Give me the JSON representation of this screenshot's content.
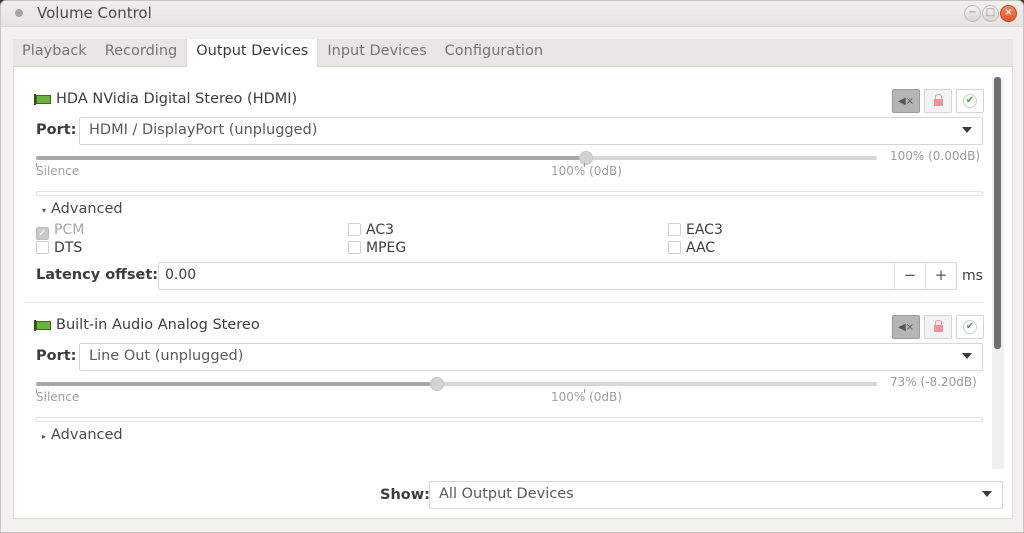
{
  "window": {
    "title": "Volume Control",
    "controls": {
      "minimize": "−",
      "maximize": "□",
      "close": "×"
    }
  },
  "tabs": [
    {
      "label": "Playback",
      "active": false
    },
    {
      "label": "Recording",
      "active": false
    },
    {
      "label": "Output Devices",
      "active": true
    },
    {
      "label": "Input Devices",
      "active": false
    },
    {
      "label": "Configuration",
      "active": false
    }
  ],
  "devices": [
    {
      "name": "HDA NVidia Digital Stereo (HDMI)",
      "icon": "sound-card-icon",
      "buttons": {
        "mute": "mute-icon",
        "lock": "lock-channels-icon",
        "default": "set-default-icon"
      },
      "mute_glyph": "◀×",
      "check_glyph": "✔",
      "port_label": "Port:",
      "port_value": "HDMI / DisplayPort (unplugged)",
      "volume_percent": 100,
      "volume_text": "100% (0.00dB)",
      "scale_marks": {
        "silence": "Silence",
        "base": "100% (0dB)"
      },
      "advanced": {
        "label": "Advanced",
        "expanded": true,
        "arrow": "▾",
        "codecs": [
          {
            "label": "PCM",
            "checked": true,
            "disabled": true
          },
          {
            "label": "AC3",
            "checked": false,
            "disabled": false
          },
          {
            "label": "EAC3",
            "checked": false,
            "disabled": false
          },
          {
            "label": "DTS",
            "checked": false,
            "disabled": false
          },
          {
            "label": "MPEG",
            "checked": false,
            "disabled": false
          },
          {
            "label": "AAC",
            "checked": false,
            "disabled": false
          }
        ],
        "latency_label": "Latency offset:",
        "latency_value": "0.00",
        "latency_minus": "−",
        "latency_plus": "+",
        "latency_unit": "ms"
      }
    },
    {
      "name": "Built-in Audio Analog Stereo",
      "icon": "sound-card-icon",
      "mute_glyph": "◀×",
      "check_glyph": "✔",
      "port_label": "Port:",
      "port_value": "Line Out (unplugged)",
      "volume_percent": 73,
      "volume_text": "73% (-8.20dB)",
      "scale_marks": {
        "silence": "Silence",
        "base": "100% (0dB)"
      },
      "advanced": {
        "label": "Advanced",
        "expanded": false,
        "arrow": "▸"
      }
    }
  ],
  "footer": {
    "show_label": "Show:",
    "show_value": "All Output Devices"
  }
}
